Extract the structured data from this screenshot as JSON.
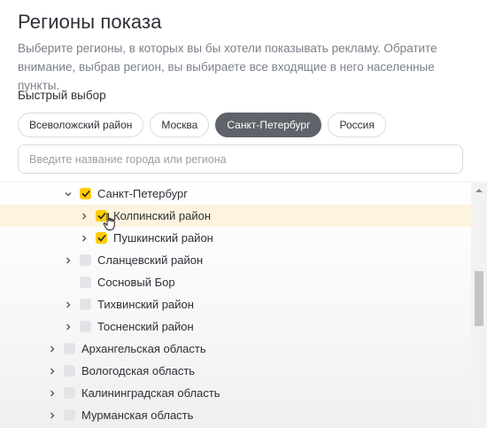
{
  "title": "Регионы показа",
  "description": "Выберите регионы, в которых вы бы хотели показывать рекламу. Обратите внимание, выбрав регион, вы выбираете все входящие в него населенные пункты.",
  "quick_select": {
    "label": "Быстрый выбор",
    "chips": [
      {
        "label": "Всеволожский район",
        "active": false
      },
      {
        "label": "Москва",
        "active": false
      },
      {
        "label": "Санкт-Петербург",
        "active": true
      },
      {
        "label": "Россия",
        "active": false
      }
    ]
  },
  "search": {
    "placeholder": "Введите название города или региона"
  },
  "tree": [
    {
      "label": "Санкт-Петербург",
      "expanded": true,
      "checked": true
    },
    {
      "label": "Колпинский район",
      "expanded": false,
      "checked": true,
      "highlighted": true
    },
    {
      "label": "Пушкинский район",
      "expanded": false,
      "checked": true
    },
    {
      "label": "Сланцевский район",
      "expanded": false,
      "checked": false
    },
    {
      "label": "Сосновый Бор",
      "checked": false
    },
    {
      "label": "Тихвинский район",
      "expanded": false,
      "checked": false
    },
    {
      "label": "Тосненский район",
      "expanded": false,
      "checked": false
    },
    {
      "label": "Архангельская область",
      "expanded": false,
      "checked": false
    },
    {
      "label": "Вологодская область",
      "expanded": false,
      "checked": false
    },
    {
      "label": "Калининградская область",
      "expanded": false,
      "checked": false
    },
    {
      "label": "Мурманская область",
      "expanded": false,
      "checked": false
    }
  ],
  "colors": {
    "accent": "#ffcc00",
    "chip_active": "#5e6269",
    "highlight": "#fdf3de"
  }
}
